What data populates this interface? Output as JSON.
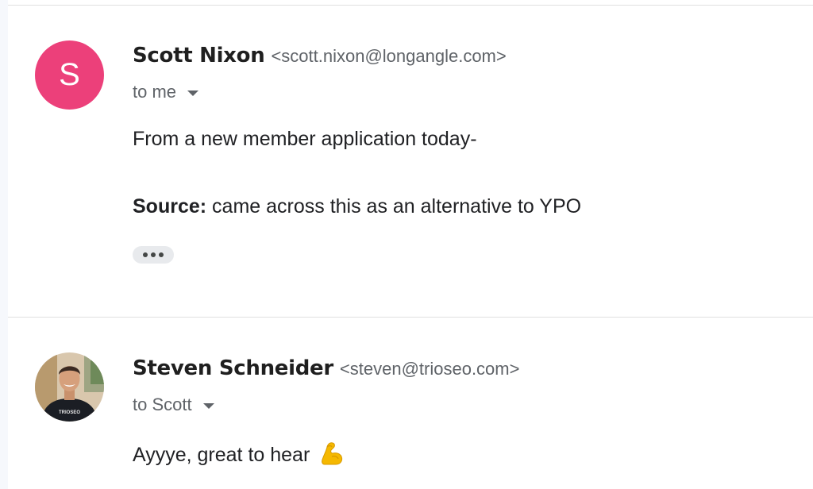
{
  "messages": [
    {
      "sender_name": "Scott Nixon",
      "sender_email": "<scott.nixon@longangle.com>",
      "avatar_letter": "S",
      "avatar_color": "#ec407a",
      "recipient": "to me",
      "body_line1": "From a new member application today-",
      "source_label": "Source:",
      "source_text": " came across this as an alternative to YPO"
    },
    {
      "sender_name": "Steven Schneider",
      "sender_email": "<steven@trioseo.com>",
      "avatar_shirt_text": "TRIOSEO",
      "recipient": "to Scott",
      "body_text": "Ayyye, great to hear",
      "body_emoji": "flexed-biceps-icon"
    }
  ]
}
